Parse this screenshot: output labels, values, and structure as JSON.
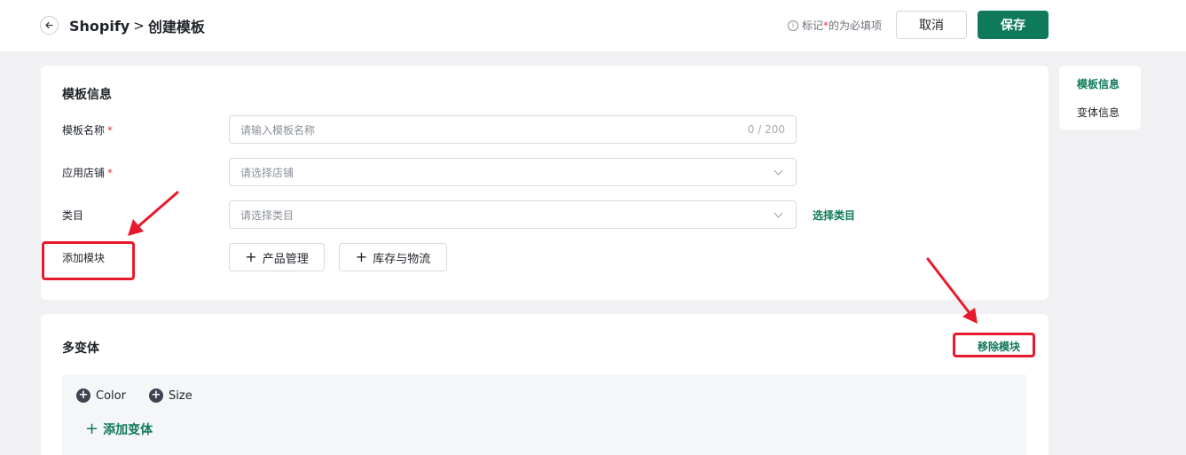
{
  "header": {
    "breadcrumb_root": "Shopify",
    "breadcrumb_separator": ">",
    "breadcrumb_current": "创建模板",
    "required_note_prefix": "标记",
    "required_note_star": "*",
    "required_note_suffix": "的为必填项",
    "cancel_label": "取消",
    "save_label": "保存"
  },
  "side_nav": {
    "items": [
      {
        "label": "模板信息",
        "active": true
      },
      {
        "label": "变体信息",
        "active": false
      }
    ]
  },
  "template_info": {
    "title": "模板信息",
    "name_label": "模板名称",
    "name_placeholder": "请输入模板名称",
    "name_count": "0 / 200",
    "store_label": "应用店铺",
    "store_placeholder": "请选择店铺",
    "category_label": "类目",
    "category_placeholder": "请选择类目",
    "category_pick_link": "选择类目",
    "add_module_label": "添加模块",
    "modules": [
      "产品管理",
      "库存与物流"
    ],
    "required_star": "*"
  },
  "variant": {
    "title": "多变体",
    "remove_label": "移除模块",
    "options": [
      "Color",
      "Size"
    ],
    "add_variant_label": "添加变体"
  },
  "colors": {
    "accent": "#0f7a5a",
    "annotation": "#e8192c",
    "required": "#e23b3b"
  }
}
